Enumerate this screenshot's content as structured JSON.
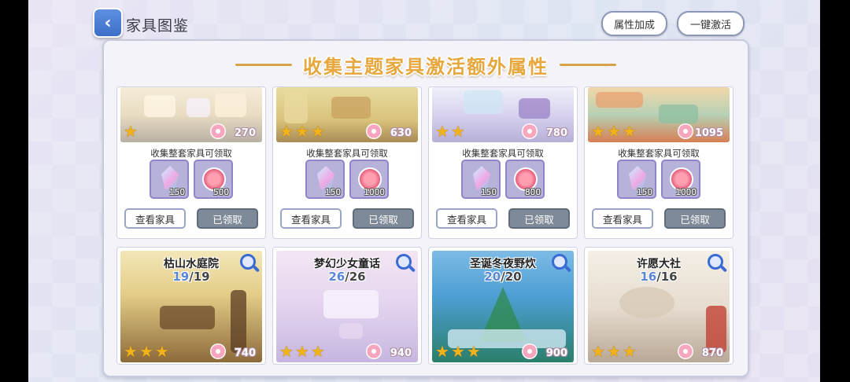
{
  "header": {
    "back_icon": "chevron-left-icon",
    "title": "家具图鉴",
    "attr_button": "属性加成",
    "activate_button": "一键激活"
  },
  "banner": {
    "text": "收集主题家具激活额外属性"
  },
  "row1": [
    {
      "stars": 1,
      "points": "270",
      "subtitle": "收集整套家具可领取",
      "rewards": [
        {
          "icon": "crystal-icon",
          "qty": "150"
        },
        {
          "icon": "coin-icon",
          "qty": "500"
        }
      ],
      "view": "查看家具",
      "claimed": "已领取"
    },
    {
      "stars": 3,
      "points": "630",
      "subtitle": "收集整套家具可领取",
      "rewards": [
        {
          "icon": "crystal-icon",
          "qty": "150"
        },
        {
          "icon": "coin-icon",
          "qty": "1000"
        }
      ],
      "view": "查看家具",
      "claimed": "已领取"
    },
    {
      "stars": 2,
      "points": "780",
      "subtitle": "收集整套家具可领取",
      "rewards": [
        {
          "icon": "crystal-icon",
          "qty": "150"
        },
        {
          "icon": "coin-icon",
          "qty": "800"
        }
      ],
      "view": "查看家具",
      "claimed": "已领取"
    },
    {
      "stars": 3,
      "points": "1095",
      "subtitle": "收集整套家具可领取",
      "rewards": [
        {
          "icon": "crystal-icon",
          "qty": "150"
        },
        {
          "icon": "coin-icon",
          "qty": "1000"
        }
      ],
      "view": "查看家具",
      "claimed": "已领取"
    }
  ],
  "row2": [
    {
      "title": "枯山水庭院",
      "current": "19",
      "total": "/19",
      "stars": 3,
      "points": "740"
    },
    {
      "title": "梦幻少女童话",
      "current": "26",
      "total": "/26",
      "stars": 3,
      "points": "940"
    },
    {
      "title": "圣诞冬夜野炊",
      "current": "20",
      "total": "/20",
      "stars": 3,
      "points": "900"
    },
    {
      "title": "许愿大社",
      "current": "16",
      "total": "/16",
      "stars": 3,
      "points": "870"
    }
  ],
  "colors": {
    "accent_blue": "#3e6fc8",
    "banner_gold": "#e6a73d",
    "star_gold": "#f2b21c",
    "progress_blue": "#5a86d6"
  }
}
